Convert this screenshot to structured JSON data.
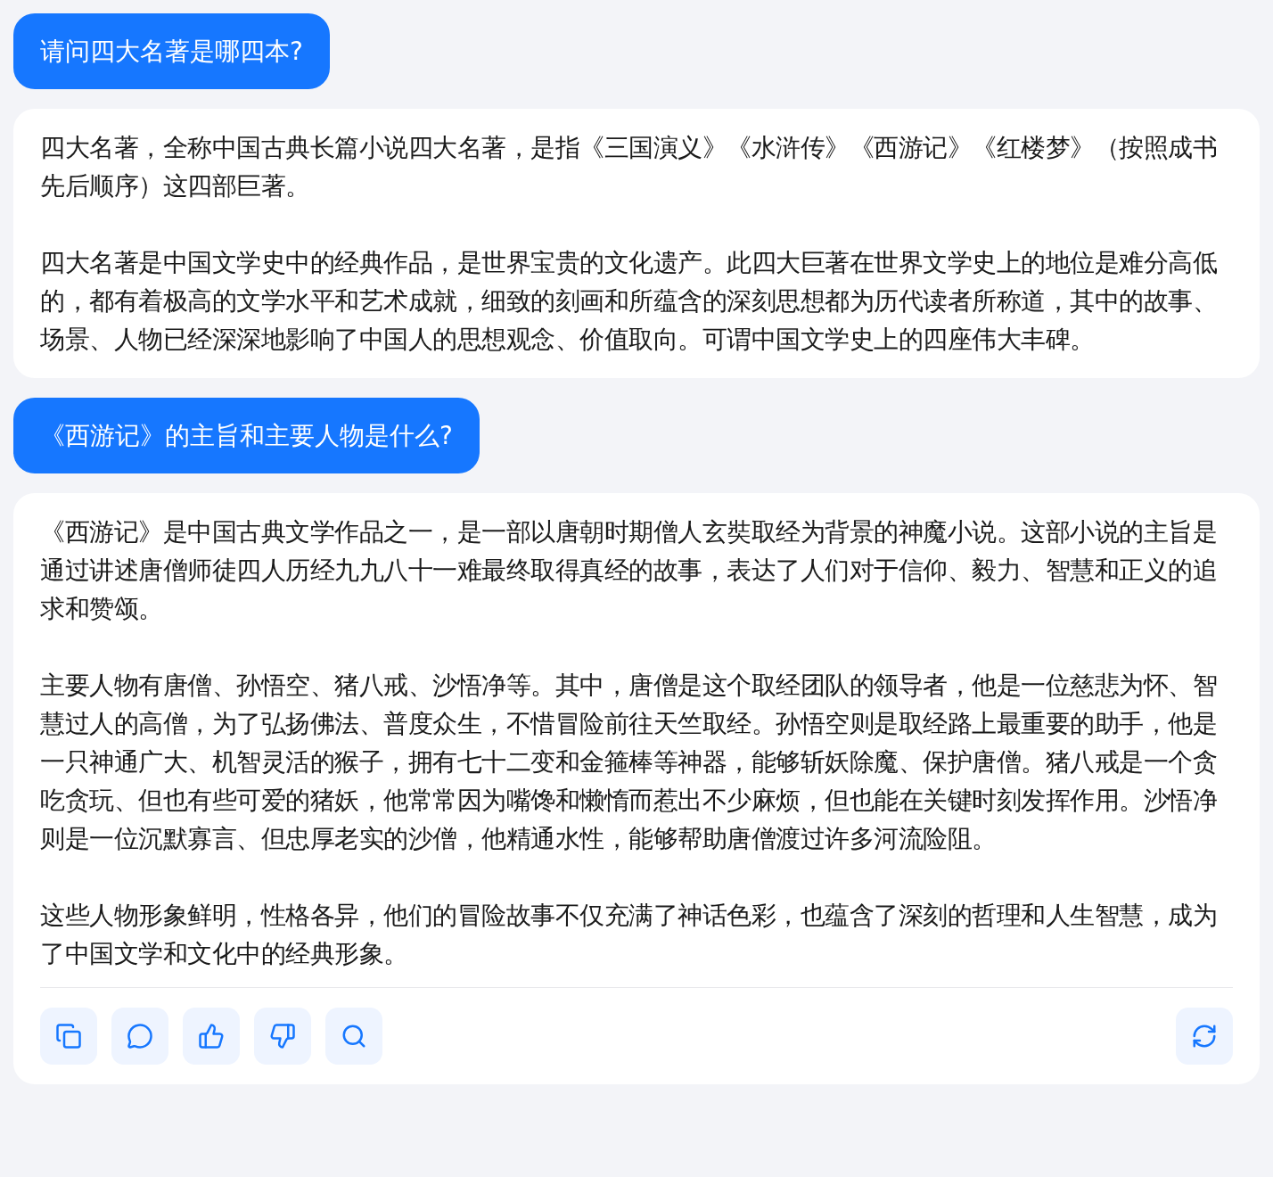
{
  "messages": [
    {
      "kind": "user",
      "text": "请问四大名著是哪四本?"
    },
    {
      "kind": "assistant",
      "paragraphs": [
        "四大名著，全称中国古典长篇小说四大名著，是指《三国演义》《水浒传》《西游记》《红楼梦》（按照成书先后顺序）这四部巨著。",
        "四大名著是中国文学史中的经典作品，是世界宝贵的文化遗产。此四大巨著在世界文学史上的地位是难分高低的，都有着极高的文学水平和艺术成就，细致的刻画和所蕴含的深刻思想都为历代读者所称道，其中的故事、场景、人物已经深深地影响了中国人的思想观念、价值取向。可谓中国文学史上的四座伟大丰碑。"
      ],
      "actions": false
    },
    {
      "kind": "user",
      "text": "《西游记》的主旨和主要人物是什么?"
    },
    {
      "kind": "assistant",
      "paragraphs": [
        "《西游记》是中国古典文学作品之一，是一部以唐朝时期僧人玄奘取经为背景的神魔小说。这部小说的主旨是通过讲述唐僧师徒四人历经九九八十一难最终取得真经的故事，表达了人们对于信仰、毅力、智慧和正义的追求和赞颂。",
        "主要人物有唐僧、孙悟空、猪八戒、沙悟净等。其中，唐僧是这个取经团队的领导者，他是一位慈悲为怀、智慧过人的高僧，为了弘扬佛法、普度众生，不惜冒险前往天竺取经。孙悟空则是取经路上最重要的助手，他是一只神通广大、机智灵活的猴子，拥有七十二变和金箍棒等神器，能够斩妖除魔、保护唐僧。猪八戒是一个贪吃贪玩、但也有些可爱的猪妖，他常常因为嘴馋和懒惰而惹出不少麻烦，但也能在关键时刻发挥作用。沙悟净则是一位沉默寡言、但忠厚老实的沙僧，他精通水性，能够帮助唐僧渡过许多河流险阻。",
        "这些人物形象鲜明，性格各异，他们的冒险故事不仅充满了神话色彩，也蕴含了深刻的哲理和人生智慧，成为了中国文学和文化中的经典形象。"
      ],
      "actions": true
    }
  ]
}
